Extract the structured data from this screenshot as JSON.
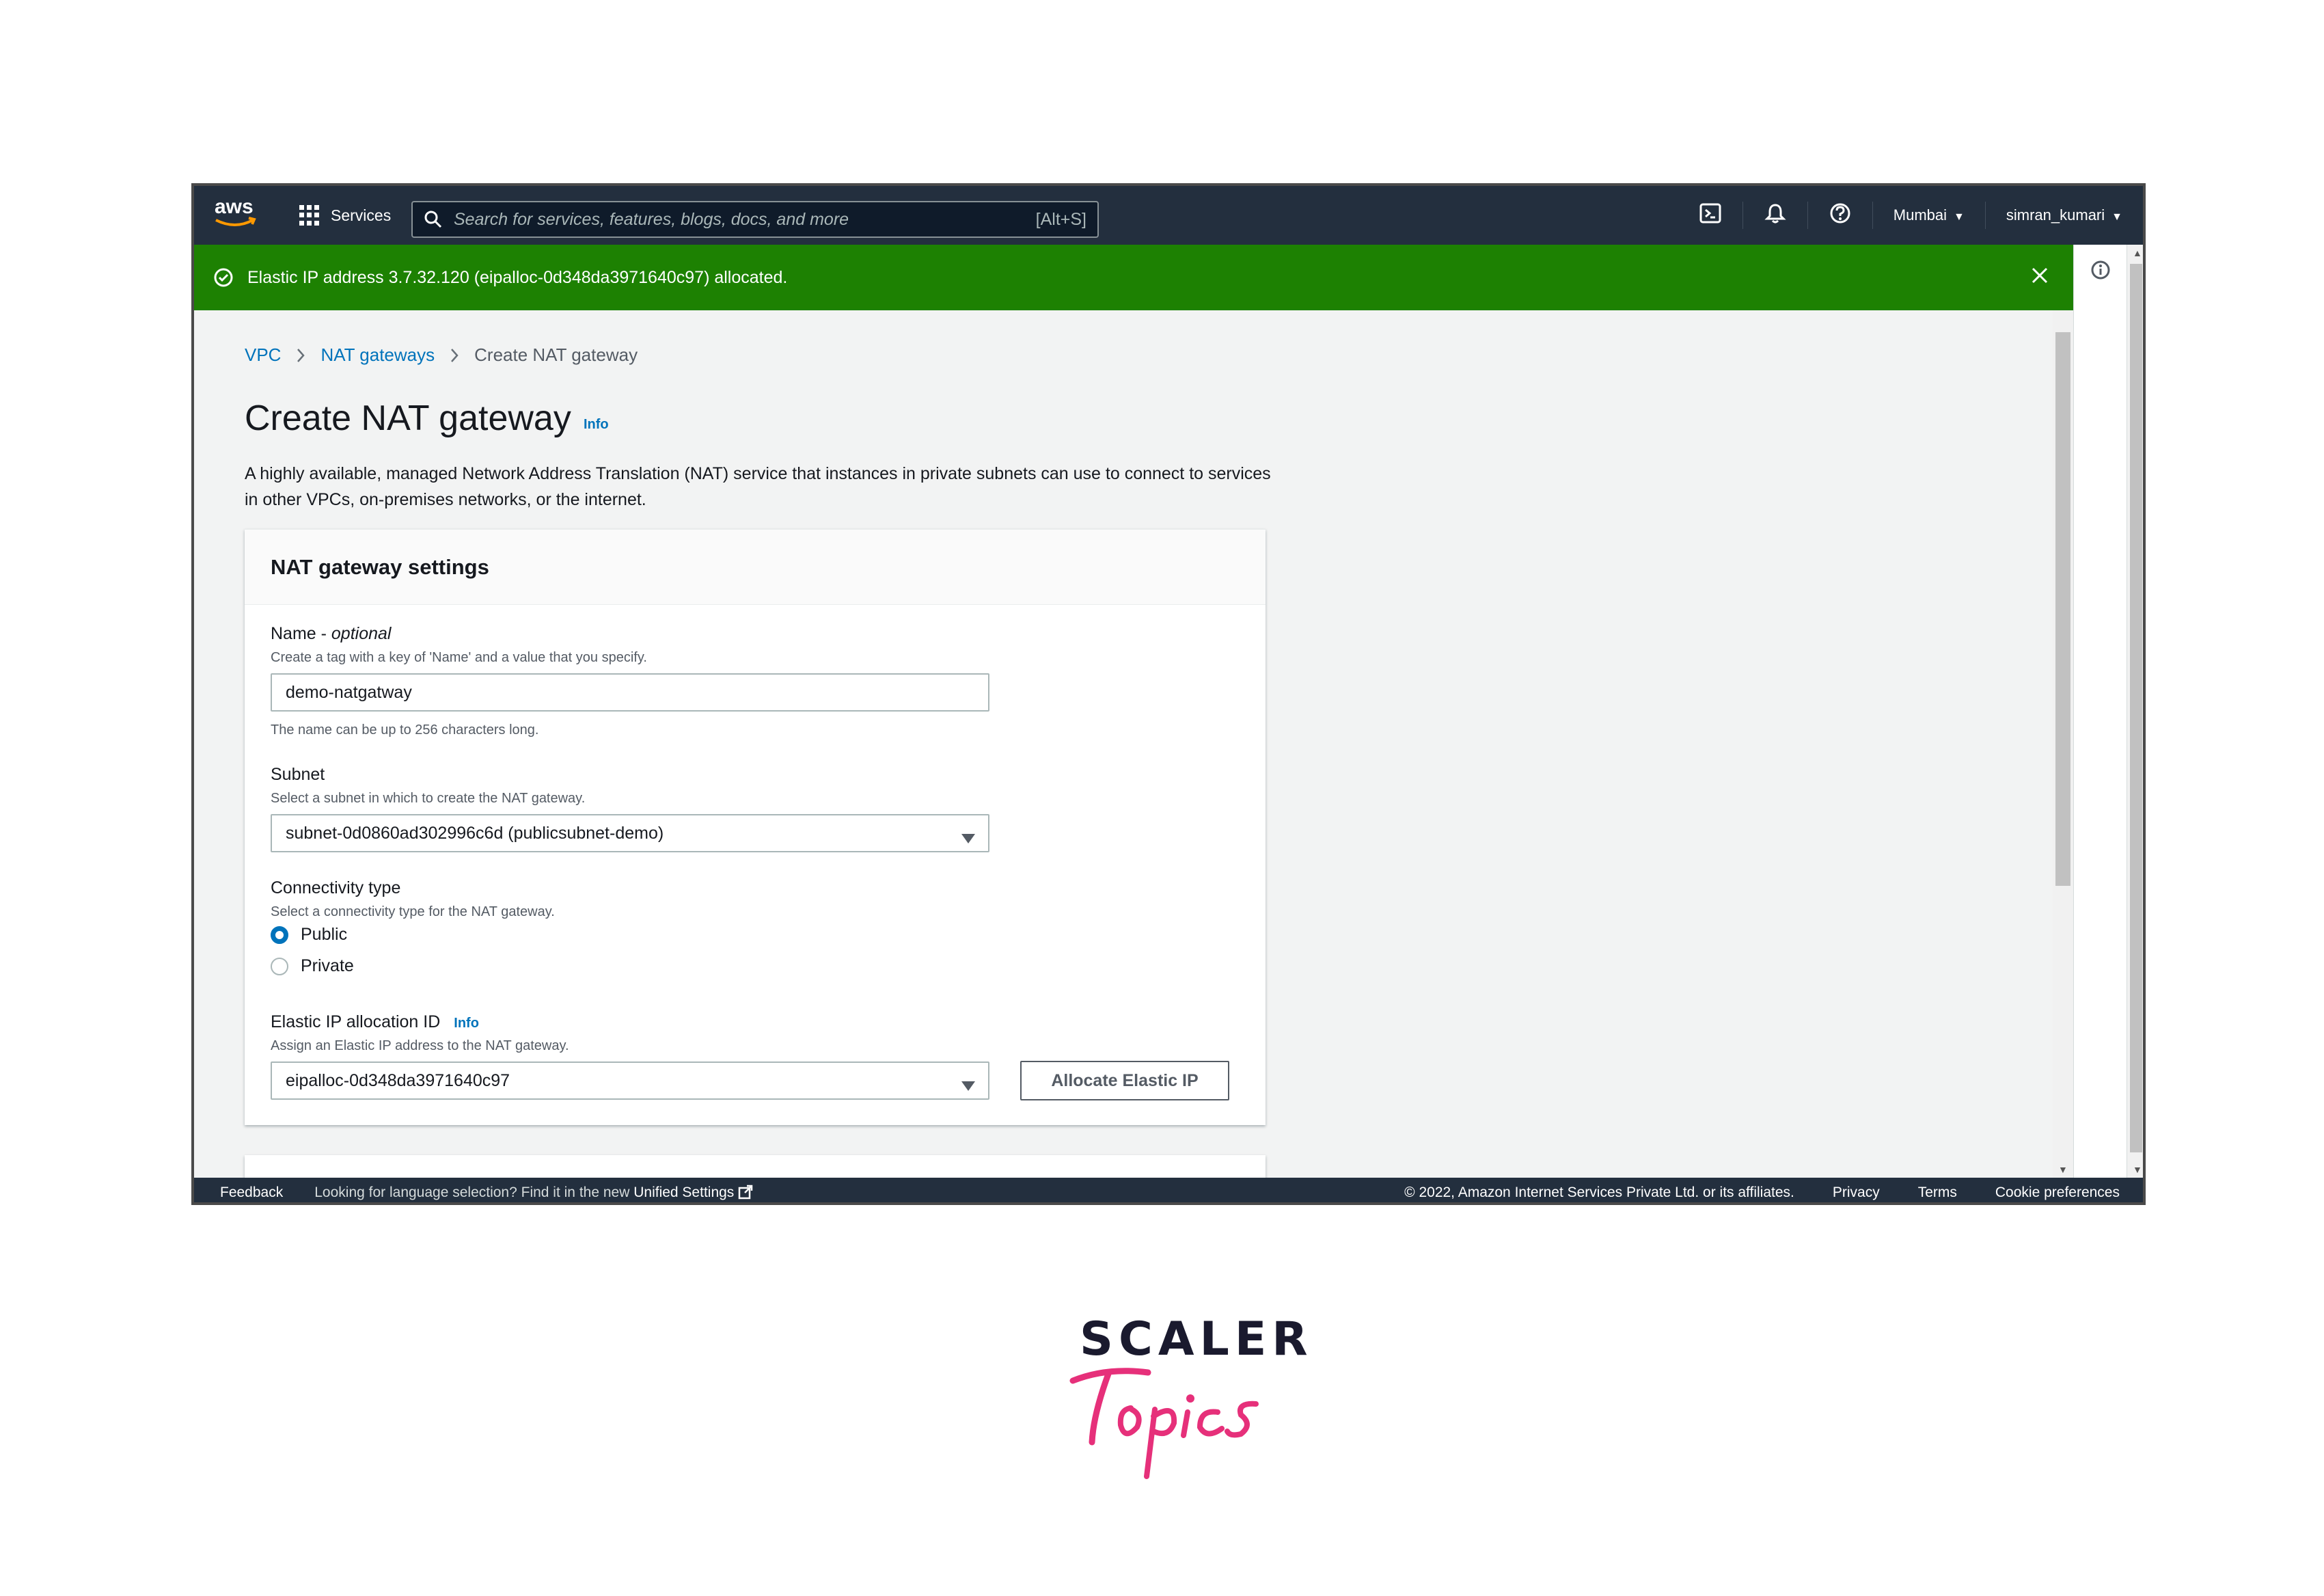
{
  "topnav": {
    "logo_text": "aws",
    "services_label": "Services",
    "search_placeholder": "Search for services, features, blogs, docs, and more",
    "search_shortcut": "[Alt+S]",
    "region": "Mumbai",
    "user": "simran_kumari",
    "icons": [
      "cloudshell-icon",
      "bell-icon",
      "help-icon"
    ]
  },
  "flash": {
    "message": "Elastic IP address 3.7.32.120 (eipalloc-0d348da3971640c97) allocated.",
    "color": "#1d8102"
  },
  "breadcrumb": {
    "items": [
      "VPC",
      "NAT gateways",
      "Create NAT gateway"
    ]
  },
  "page": {
    "title": "Create NAT gateway",
    "info_label": "Info",
    "description": "A highly available, managed Network Address Translation (NAT) service that instances in private subnets can use to connect to services in other VPCs, on-premises networks, or the internet."
  },
  "panel": {
    "title": "NAT gateway settings",
    "name": {
      "label": "Name - ",
      "optional": "optional",
      "description": "Create a tag with a key of 'Name' and a value that you specify.",
      "value": "demo-natgatway",
      "constraint": "The name can be up to 256 characters long."
    },
    "subnet": {
      "label": "Subnet",
      "description": "Select a subnet in which to create the NAT gateway.",
      "value": "subnet-0d0860ad302996c6d (publicsubnet-demo)"
    },
    "connectivity": {
      "label": "Connectivity type",
      "description": "Select a connectivity type for the NAT gateway.",
      "options": [
        "Public",
        "Private"
      ],
      "selected": "Public"
    },
    "eip": {
      "label": "Elastic IP allocation ID",
      "info_label": "Info",
      "description": "Assign an Elastic IP address to the NAT gateway.",
      "value": "eipalloc-0d348da3971640c97",
      "button_label": "Allocate Elastic IP"
    }
  },
  "footer": {
    "feedback": "Feedback",
    "lang_text": "Looking for language selection? Find it in the new",
    "unified_settings": "Unified Settings",
    "copyright": "© 2022, Amazon Internet Services Private Ltd. or its affiliates.",
    "privacy": "Privacy",
    "terms": "Terms",
    "cookies": "Cookie preferences"
  },
  "brand": {
    "line1": "SCALER",
    "line2": "Topics",
    "accent": "#e6307a"
  }
}
